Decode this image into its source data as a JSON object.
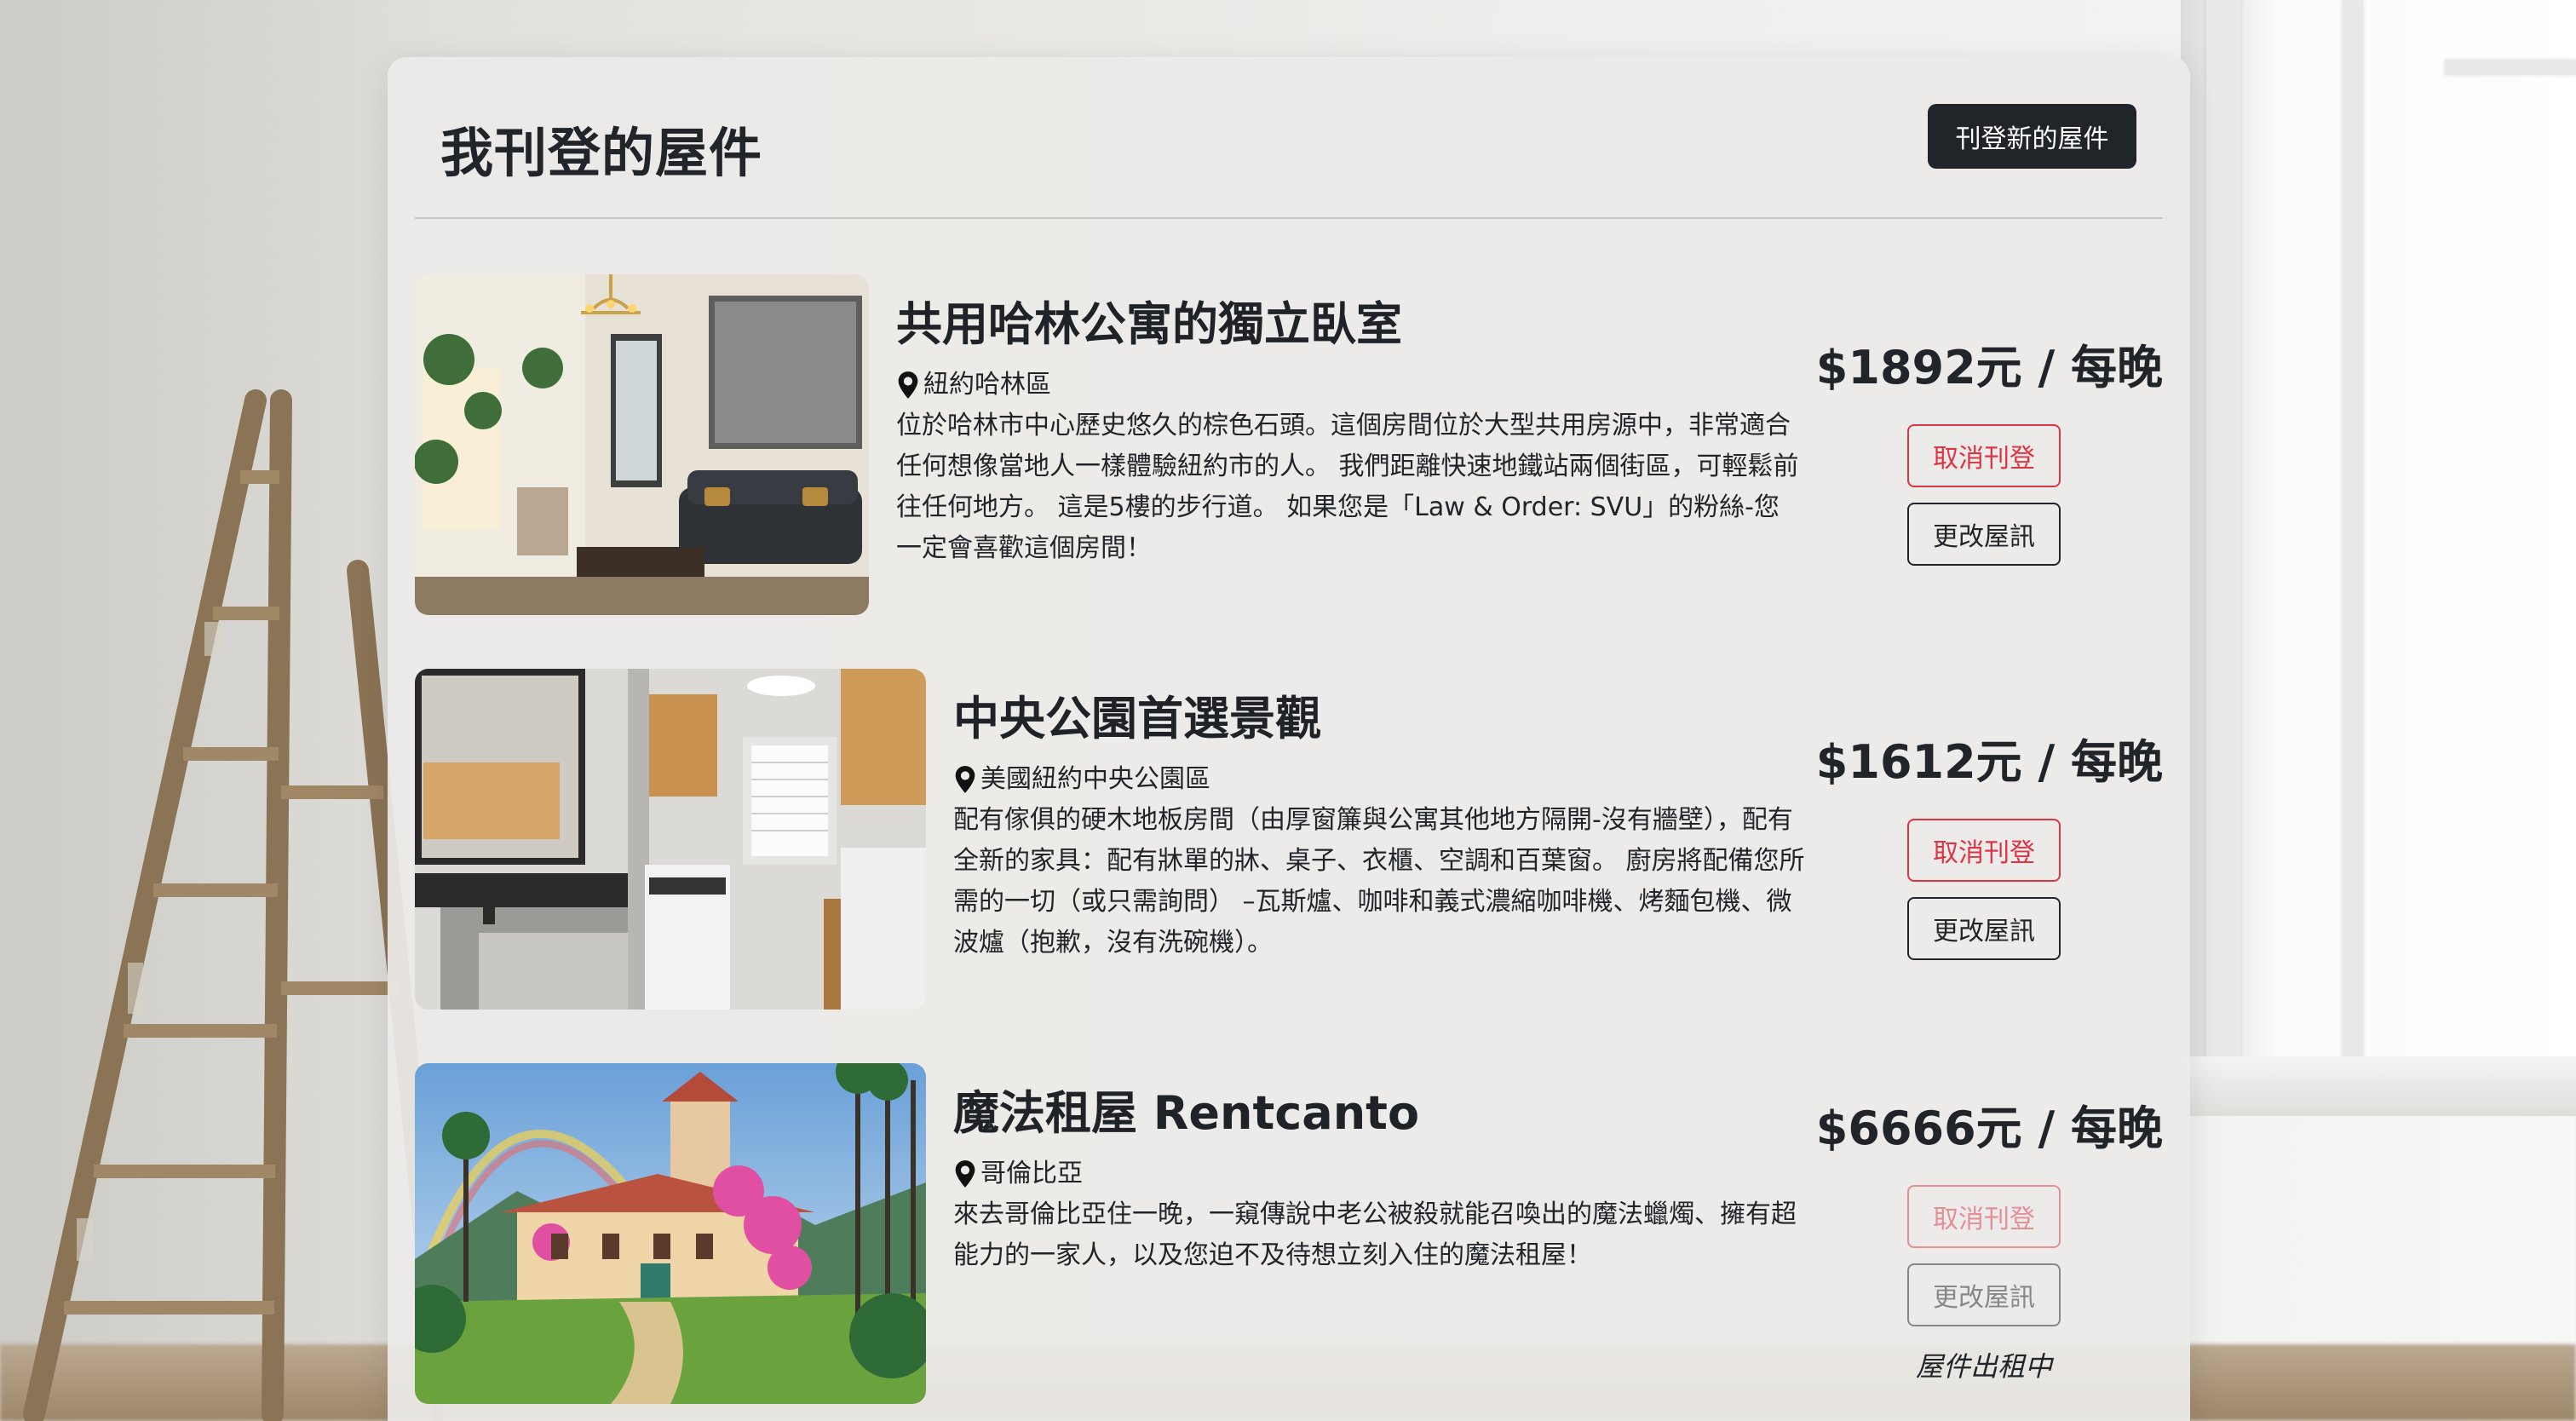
{
  "page": {
    "title": "我刊登的屋件",
    "new_listing_label": "刊登新的屋件"
  },
  "listings": [
    {
      "title": "共用哈林公寓的獨立臥室",
      "location": "紐約哈林區",
      "description": "位於哈林市中心歷史悠久的棕色石頭。這個房間位於大型共用房源中，非常適合任何想像當地人一樣體驗紐約市的人。 我們距離快速地鐵站兩個街區，可輕鬆前往任何地方。 這是5樓的步行道。 如果您是「Law & Order: SVU」的粉絲-您一定會喜歡這個房間！",
      "price": "$1892元 / 每晚",
      "cancel_label": "取消刊登",
      "edit_label": "更改屋訊",
      "image_icon": "living-room-photo"
    },
    {
      "title": "中央公園首選景觀",
      "location": "美國紐約中央公園區",
      "description": "配有傢俱的硬木地板房間（由厚窗簾與公寓其他地方隔開-沒有牆壁），配有全新的家具：配有牀單的牀、桌子、衣櫃、空調和百葉窗。 廚房將配備您所需的一切（或只需詢問） –瓦斯爐、咖啡和義式濃縮咖啡機、烤麵包機、微波爐（抱歉，沒有洗碗機）。",
      "price": "$1612元 / 每晚",
      "cancel_label": "取消刊登",
      "edit_label": "更改屋訊",
      "image_icon": "kitchen-photo"
    },
    {
      "title": "魔法租屋 Rentcanto",
      "location": "哥倫比亞",
      "description": "來去哥倫比亞住一晚，一窺傳說中老公被殺就能召喚出的魔法蠟燭、擁有超能力的一家人，以及您迫不及待想立刻入住的魔法租屋！",
      "price": "$6666元 / 每晚",
      "cancel_label": "取消刊登",
      "edit_label": "更改屋訊",
      "status": "屋件出租中",
      "image_icon": "magic-house-photo"
    }
  ],
  "colors": {
    "primary_dark": "#212529",
    "danger": "#dc3545",
    "card_bg": "#ecebe8"
  }
}
